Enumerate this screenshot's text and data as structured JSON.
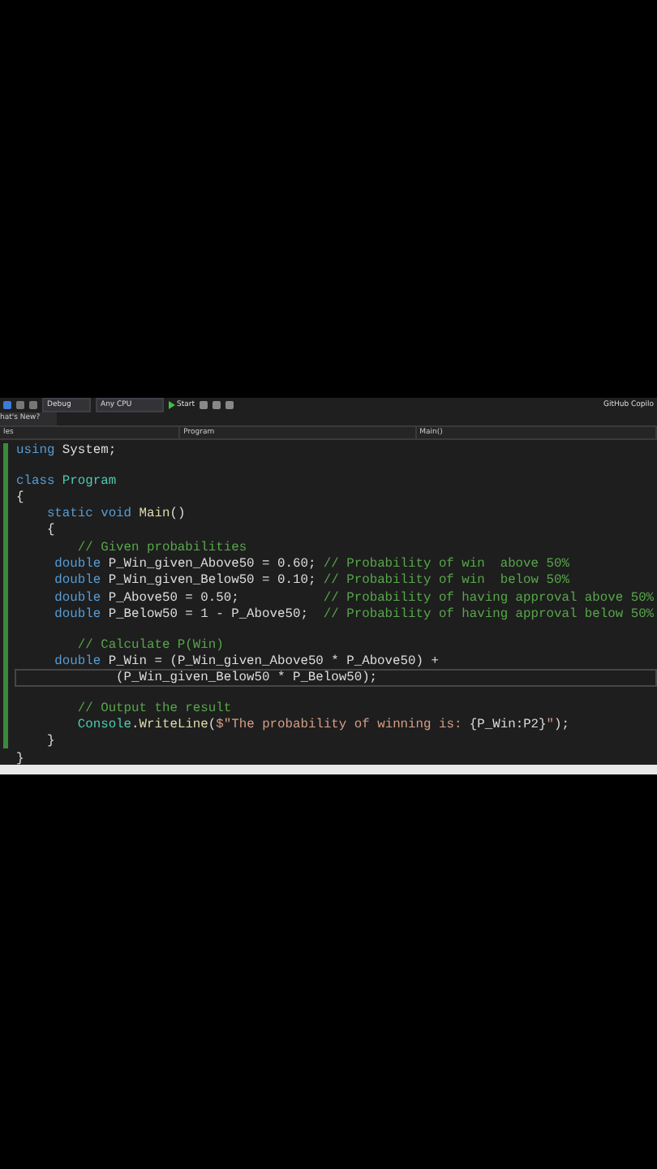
{
  "toolbar": {
    "configuration": "Debug",
    "platform": "Any CPU",
    "start": "Start",
    "copilot": "GitHub Copilo"
  },
  "tabs": [
    {
      "label": "hat's New?",
      "selected": true
    }
  ],
  "navigation": {
    "project": "les",
    "type": "Program",
    "member": "Main()"
  },
  "code": [
    {
      "kind": "top",
      "current": false,
      "tokens": [
        {
          "kind": "kw",
          "text": "using"
        },
        {
          "kind": "plain",
          "text": " System;"
        }
      ]
    },
    {
      "kind": "blank"
    },
    {
      "kind": "top",
      "current": false,
      "tokens": [
        {
          "kind": "kw",
          "text": "class"
        },
        {
          "kind": "type",
          "text": " Program"
        }
      ]
    },
    {
      "kind": "top",
      "current": false,
      "tokens": [
        {
          "kind": "plain",
          "text": "{"
        }
      ]
    },
    {
      "kind": "member",
      "current": false,
      "tokens": [
        {
          "kind": "kw",
          "text": "static void"
        },
        {
          "kind": "method",
          "text": " Main"
        },
        {
          "kind": "plain",
          "text": "()"
        }
      ]
    },
    {
      "kind": "member",
      "current": false,
      "tokens": [
        {
          "kind": "plain",
          "text": "{"
        }
      ]
    },
    {
      "kind": "body",
      "current": false,
      "tokens": [
        {
          "kind": "comment",
          "text": "// Given probabilities"
        }
      ]
    },
    {
      "kind": "decl",
      "current": false,
      "tokens": [
        {
          "kind": "kw",
          "text": "double"
        },
        {
          "kind": "var",
          "text": " P_Win_given_Above50 = 0.60; "
        },
        {
          "kind": "comment",
          "text": "// Probability of win  above 50%"
        }
      ]
    },
    {
      "kind": "decl",
      "current": false,
      "tokens": [
        {
          "kind": "kw",
          "text": "double"
        },
        {
          "kind": "var",
          "text": " P_Win_given_Below50 = 0.10; "
        },
        {
          "kind": "comment",
          "text": "// Probability of win  below 50%"
        }
      ]
    },
    {
      "kind": "decl",
      "current": false,
      "tokens": [
        {
          "kind": "kw",
          "text": "double"
        },
        {
          "kind": "var",
          "text": " P_Above50 = 0.50;           "
        },
        {
          "kind": "comment",
          "text": "// Probability of having approval above 50%"
        }
      ]
    },
    {
      "kind": "decl",
      "current": false,
      "tokens": [
        {
          "kind": "kw",
          "text": "double"
        },
        {
          "kind": "var",
          "text": " P_Below50 = 1 - P_Above50;  "
        },
        {
          "kind": "comment",
          "text": "// Probability of having approval below 50%"
        }
      ]
    },
    {
      "kind": "blank"
    },
    {
      "kind": "body",
      "current": false,
      "tokens": [
        {
          "kind": "comment",
          "text": "// Calculate P(Win)"
        }
      ]
    },
    {
      "kind": "decl",
      "current": false,
      "tokens": [
        {
          "kind": "kw",
          "text": "double"
        },
        {
          "kind": "var",
          "text": " P_Win = (P_Win_given_Above50 * P_Above50) +"
        }
      ]
    },
    {
      "kind": "cont",
      "current": true,
      "tokens": [
        {
          "kind": "var",
          "text": "(P_Win_given_Below50 * P_Below50);"
        }
      ]
    },
    {
      "kind": "blank"
    },
    {
      "kind": "body",
      "current": false,
      "tokens": [
        {
          "kind": "comment",
          "text": "// Output the result"
        }
      ]
    },
    {
      "kind": "body",
      "current": false,
      "tokens": [
        {
          "kind": "type",
          "text": "Console"
        },
        {
          "kind": "plain",
          "text": "."
        },
        {
          "kind": "method",
          "text": "WriteLine"
        },
        {
          "kind": "plain",
          "text": "("
        },
        {
          "kind": "string",
          "text": "$\"The probability of winning is: "
        },
        {
          "kind": "var",
          "text": "{P_Win:P2}"
        },
        {
          "kind": "string",
          "text": "\""
        },
        {
          "kind": "plain",
          "text": ");"
        }
      ]
    },
    {
      "kind": "member",
      "current": false,
      "tokens": [
        {
          "kind": "plain",
          "text": "}"
        }
      ]
    },
    {
      "kind": "top",
      "current": false,
      "tokens": [
        {
          "kind": "plain",
          "text": "}"
        }
      ]
    }
  ]
}
